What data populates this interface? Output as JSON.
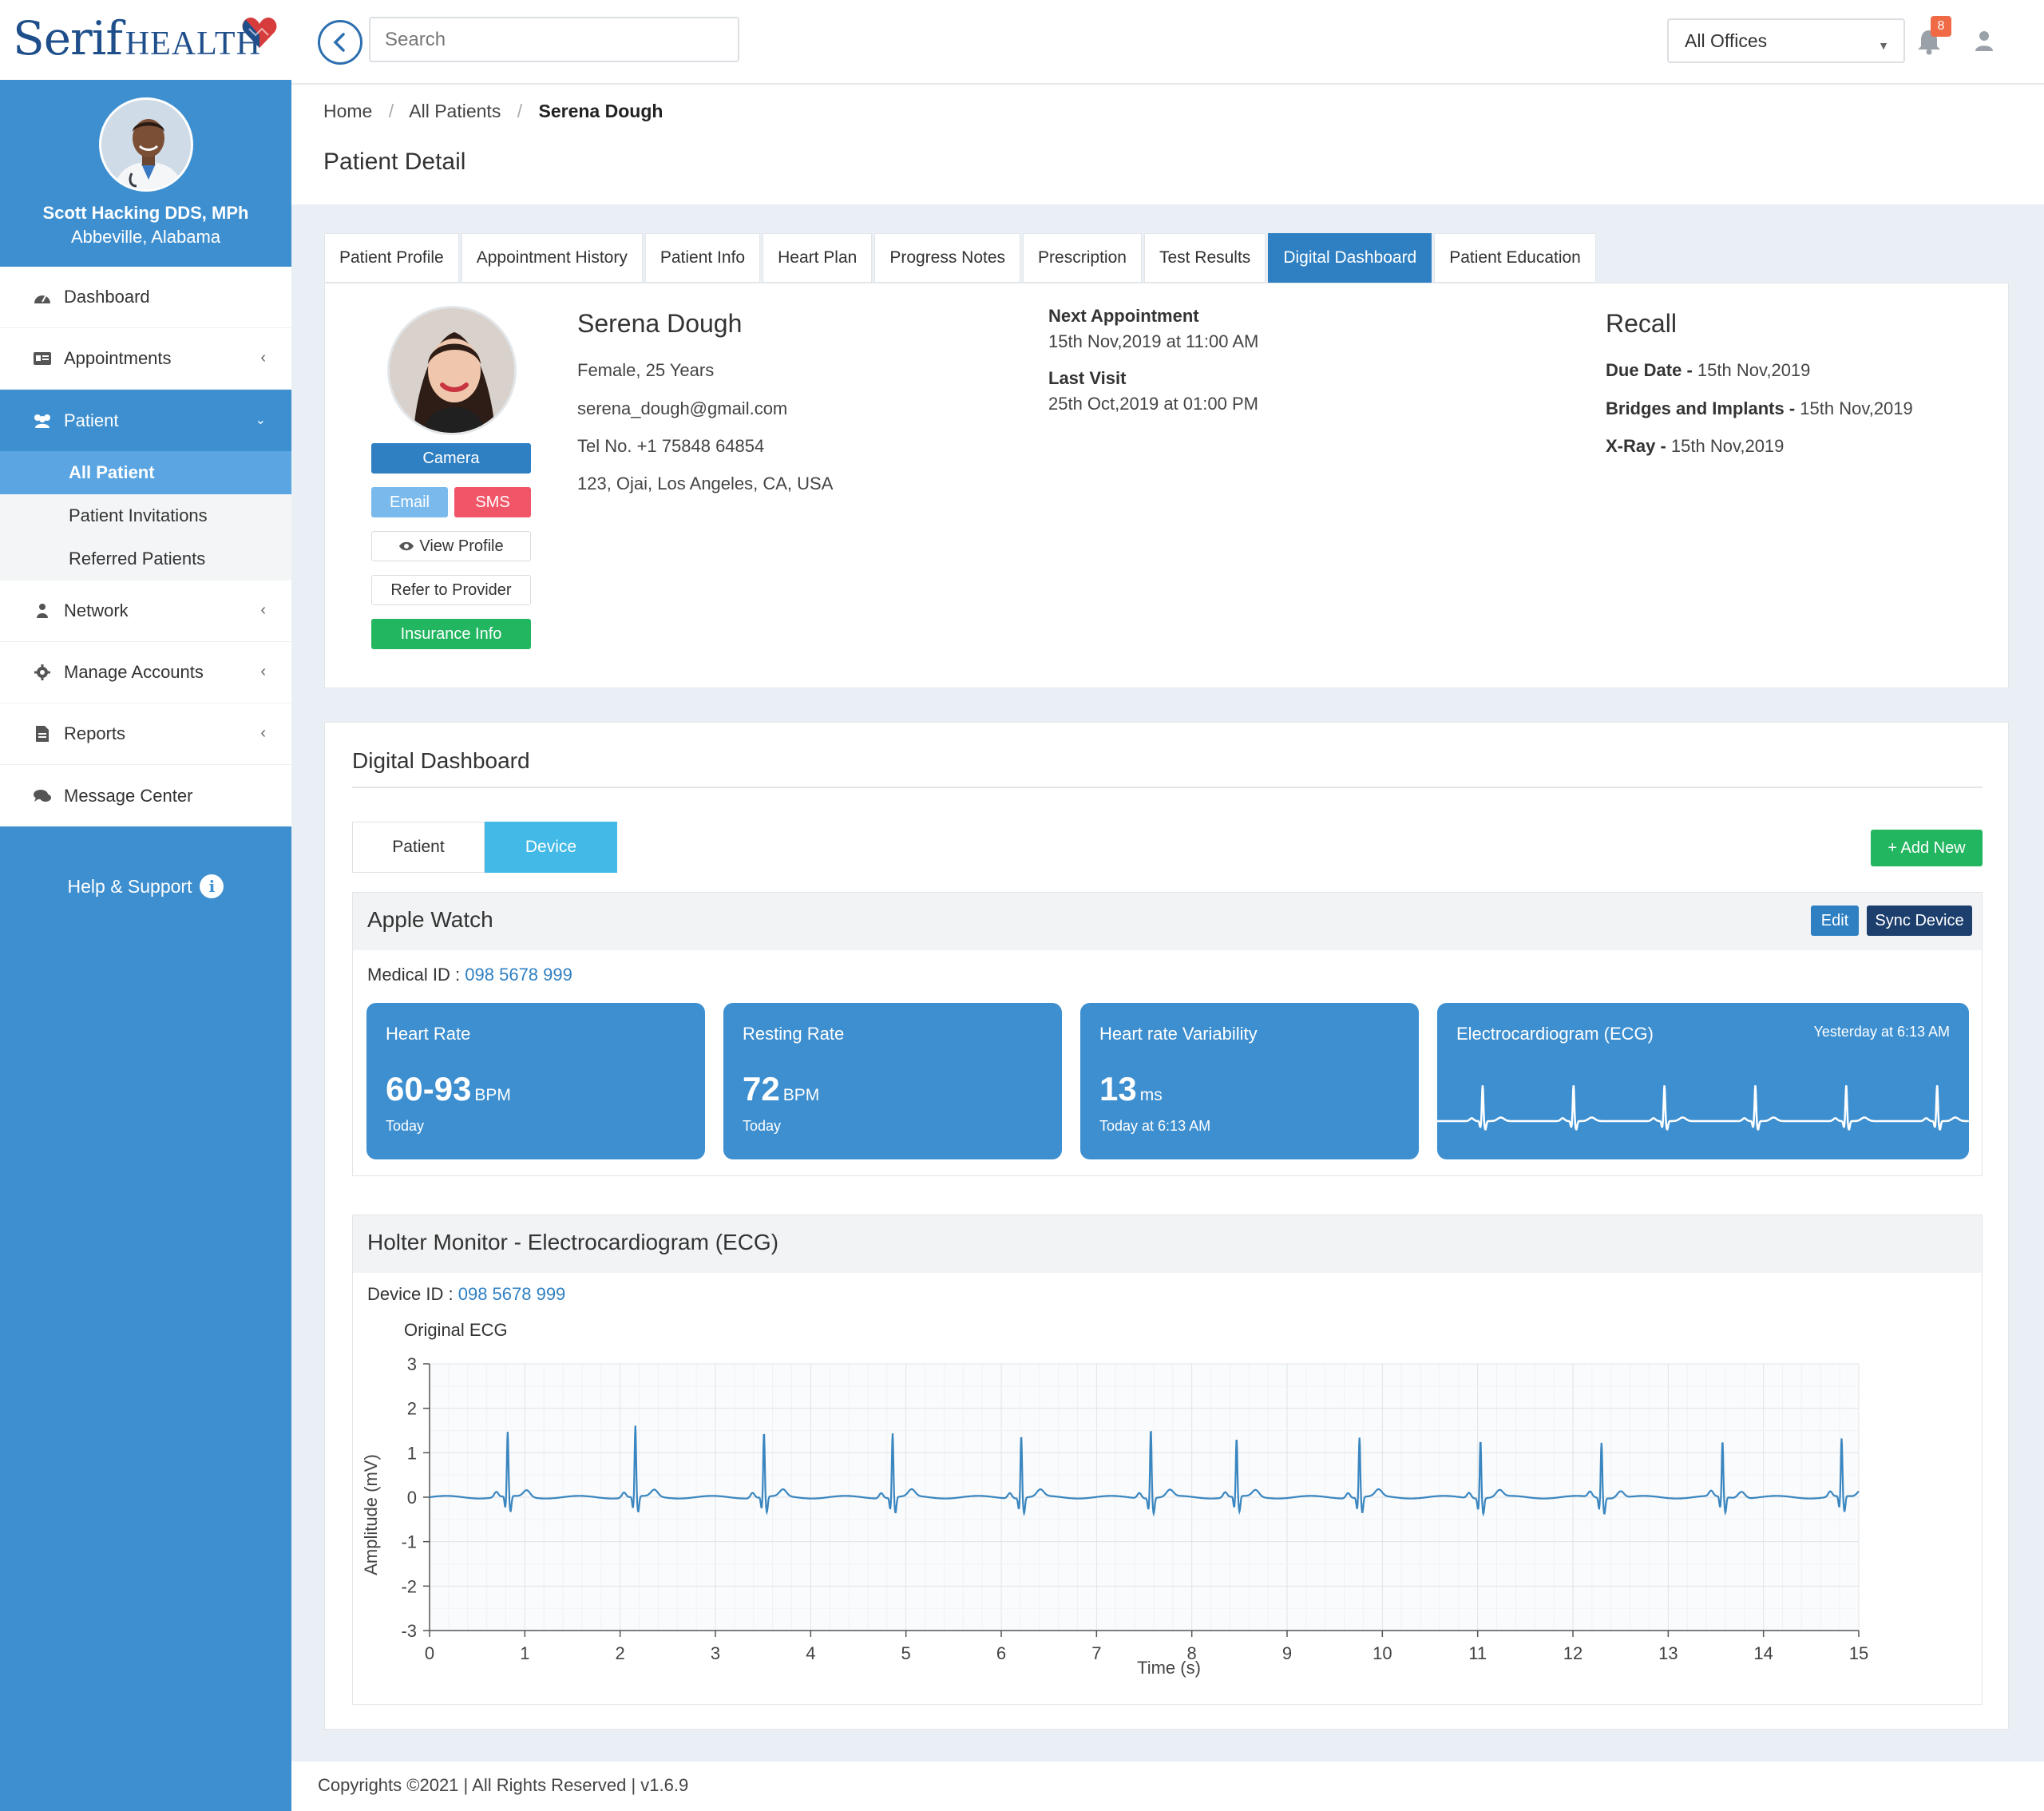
{
  "brand": {
    "name_part1": "Serif",
    "name_part2": "HEALTH"
  },
  "header": {
    "search_placeholder": "Search",
    "office_selected": "All Offices",
    "notification_count": "8"
  },
  "sidebar": {
    "user_name": "Scott Hacking DDS, MPh",
    "user_location": "Abbeville, Alabama",
    "items": [
      {
        "label": "Dashboard"
      },
      {
        "label": "Appointments"
      },
      {
        "label": "Patient"
      },
      {
        "label": "Network"
      },
      {
        "label": "Manage Accounts"
      },
      {
        "label": "Reports"
      },
      {
        "label": "Message Center"
      }
    ],
    "patient_sub": [
      {
        "label": "All Patient"
      },
      {
        "label": "Patient Invitations"
      },
      {
        "label": "Referred Patients"
      }
    ],
    "help_label": "Help & Support",
    "help_icon_glyph": "i"
  },
  "breadcrumb": {
    "home": "Home",
    "all": "All Patients",
    "current": "Serena Dough"
  },
  "page_title": "Patient Detail",
  "tabs": [
    {
      "label": "Patient Profile"
    },
    {
      "label": "Appointment History"
    },
    {
      "label": "Patient Info"
    },
    {
      "label": "Heart Plan"
    },
    {
      "label": "Progress Notes"
    },
    {
      "label": "Prescription"
    },
    {
      "label": "Test Results"
    },
    {
      "label": "Digital Dashboard"
    },
    {
      "label": "Patient Education"
    }
  ],
  "patient": {
    "name": "Serena Dough",
    "gender_age": "Female, 25 Years",
    "email": "serena_dough@gmail.com",
    "phone": "Tel No. +1 75848 64854",
    "address": "123, Ojai, Los Angeles, CA, USA",
    "buttons": {
      "camera": "Camera",
      "email": "Email",
      "sms": "SMS",
      "view_profile": "View Profile",
      "refer": "Refer to Provider",
      "insurance": "Insurance Info"
    },
    "next_appointment_label": "Next Appointment",
    "next_appointment": "15th Nov,2019 at 11:00 AM",
    "last_visit_label": "Last Visit",
    "last_visit": "25th Oct,2019 at 01:00 PM",
    "recall_title": "Recall",
    "recall": [
      {
        "label": "Due Date",
        "value": "15th Nov,2019"
      },
      {
        "label": "Bridges and Implants",
        "value": "15th Nov,2019"
      },
      {
        "label": "X-Ray",
        "value": "15th Nov,2019"
      }
    ]
  },
  "digital_dashboard": {
    "title": "Digital Dashboard",
    "segment_patient": "Patient",
    "segment_device": "Device",
    "add_new": "+ Add New",
    "apple_watch": {
      "title": "Apple Watch",
      "edit": "Edit",
      "sync": "Sync Device",
      "id_label": "Medical ID :",
      "id_value": "098 5678 999",
      "metrics": [
        {
          "title": "Heart Rate",
          "value": "60-93",
          "unit": "BPM",
          "sub": "Today"
        },
        {
          "title": "Resting Rate",
          "value": "72",
          "unit": "BPM",
          "sub": "Today"
        },
        {
          "title": "Heart rate Variability",
          "value": "13",
          "unit": "ms",
          "sub": "Today at 6:13 AM"
        },
        {
          "title": "Electrocardiogram (ECG)",
          "time": "Yesterday at 6:13 AM"
        }
      ]
    },
    "holter": {
      "title": "Holter Monitor - Electrocardiogram (ECG)",
      "id_label": "Device ID :",
      "id_value": "098 5678 999"
    }
  },
  "chart_data": {
    "type": "line",
    "title": "Original ECG",
    "xlabel": "Time (s)",
    "ylabel": "Amplitude (mV)",
    "xlim": [
      0,
      15
    ],
    "ylim": [
      -3,
      3
    ],
    "xticks": [
      0,
      1,
      2,
      3,
      4,
      5,
      6,
      7,
      8,
      9,
      10,
      11,
      12,
      13,
      14,
      15
    ],
    "yticks": [
      3,
      2,
      1,
      0,
      -1,
      -2,
      -3
    ],
    "grid": true,
    "r_peaks": [
      {
        "t": 0.82,
        "amp": 1.45
      },
      {
        "t": 2.16,
        "amp": 1.6
      },
      {
        "t": 3.51,
        "amp": 1.45
      },
      {
        "t": 4.86,
        "amp": 1.45
      },
      {
        "t": 6.21,
        "amp": 1.4
      },
      {
        "t": 7.57,
        "amp": 1.55
      },
      {
        "t": 8.47,
        "amp": 1.3
      },
      {
        "t": 9.76,
        "amp": 1.35
      },
      {
        "t": 11.03,
        "amp": 1.3
      },
      {
        "t": 12.3,
        "amp": 1.25
      },
      {
        "t": 13.57,
        "amp": 1.25
      },
      {
        "t": 14.82,
        "amp": 1.3
      }
    ],
    "baseline": 0.0,
    "color": "#3a86c0"
  },
  "footer": {
    "text": "Copyrights ©2021 | All Rights Reserved | v1.6.9"
  }
}
